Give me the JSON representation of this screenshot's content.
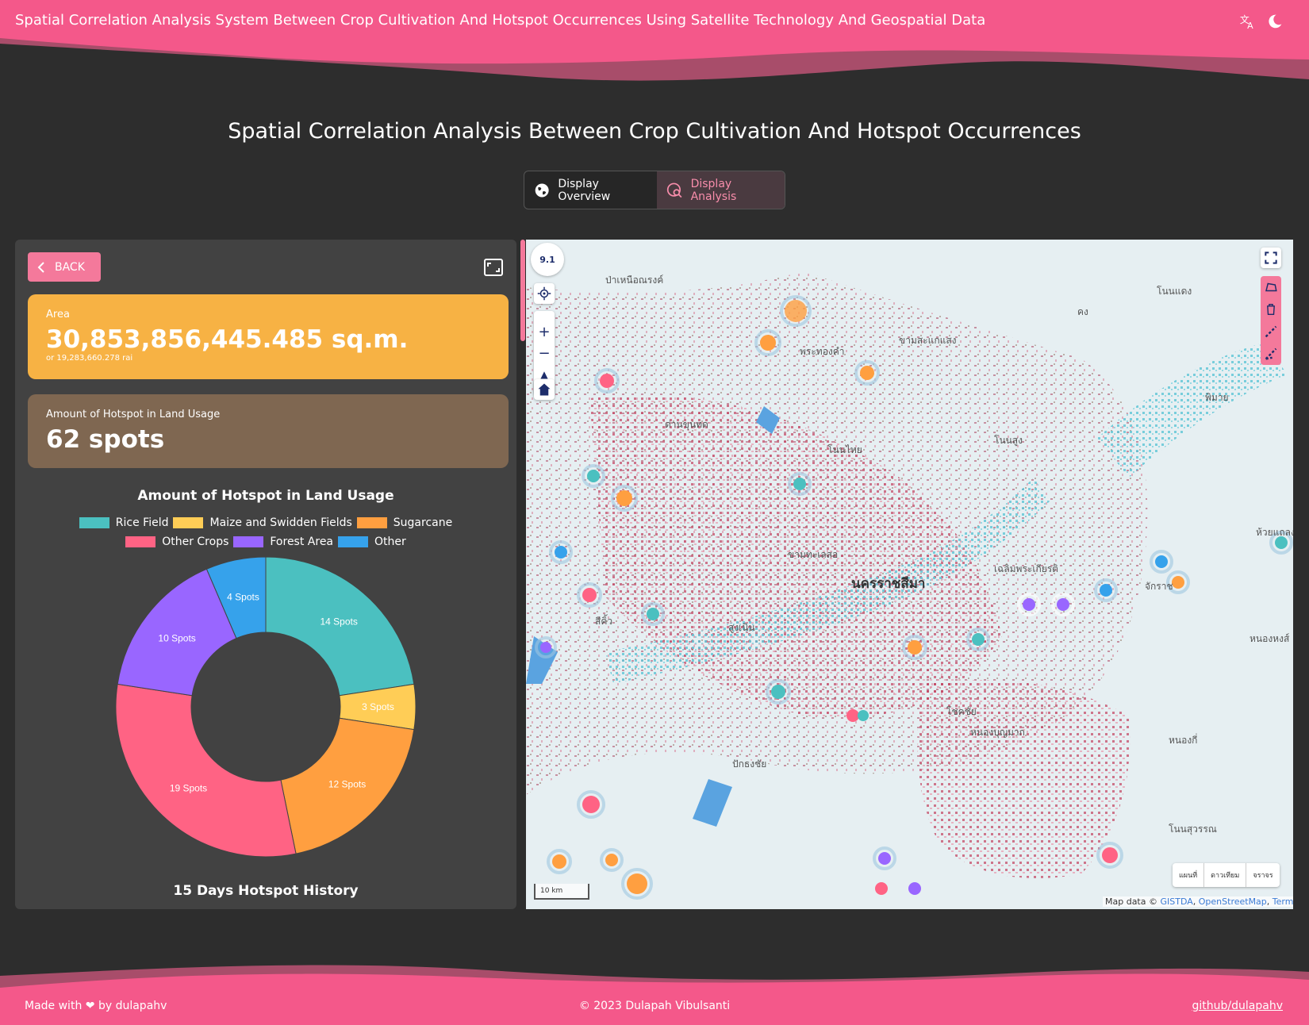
{
  "header": {
    "title": "Spatial Correlation Analysis System Between Crop Cultivation And Hotspot Occurrences Using Satellite Technology And Geospatial Data",
    "translate_icon": "translate-icon",
    "theme_icon": "moon-icon"
  },
  "page_title": "Spatial Correlation Analysis Between Crop Cultivation And Hotspot Occurrences",
  "view_toggle": {
    "overview_label": "Display Overview",
    "analysis_label": "Display Analysis",
    "active": "analysis"
  },
  "panel": {
    "back_label": "BACK",
    "area": {
      "label": "Area",
      "value": "30,853,856,445.485 sq.m.",
      "sub": "or 19,283,660.278 rai"
    },
    "hotspots": {
      "label": "Amount of Hotspot in Land Usage",
      "value": "62 spots"
    },
    "chart_title": "Amount of Hotspot in Land Usage",
    "history_title": "15 Days Hotspot History"
  },
  "chart_data": {
    "type": "pie",
    "title": "Amount of Hotspot in Land Usage",
    "legend_position": "top",
    "categories": [
      "Rice Field",
      "Maize and Swidden Fields",
      "Sugarcane",
      "Other Crops",
      "Forest Area",
      "Other"
    ],
    "values": [
      14,
      3,
      12,
      19,
      10,
      4
    ],
    "labels": [
      "14 Spots",
      "3 Spots",
      "12 Spots",
      "19 Spots",
      "10 Spots",
      "4 Spots"
    ],
    "colors": [
      "#4bc0c0",
      "#ffcd56",
      "#ff9f40",
      "#ff6384",
      "#9966ff",
      "#36a2eb"
    ]
  },
  "map": {
    "zoom_level": "9.1",
    "labels": [
      "ป่าเหนือณรงค์",
      "พระทองคำ",
      "ขามสะแกแสง",
      "ด่านขุนทด",
      "โนนไทย",
      "โนนสูง",
      "พิมาย",
      "โนนแดง",
      "คง",
      "ขามทะเลสอ",
      "นครราชสีมา",
      "เฉลิมพระเกียรติ",
      "จักราช",
      "ห้วยแถลง",
      "สีคิ้ว",
      "สูงเนิน",
      "หนองหงส์",
      "โชคชัย",
      "หนองบุญมาก",
      "หนองกี่",
      "ปักธงชัย",
      "โนนสุวรรณ"
    ],
    "base_layers": [
      "แผนที่",
      "ดาวเทียม",
      "จราจร"
    ],
    "scale": "10 km",
    "attribution_prefix": "Map data ©",
    "attribution_links": [
      "GISTDA",
      "OpenStreetMap",
      "Terms"
    ]
  },
  "footer": {
    "made_with": "Made with",
    "by": "by dulapahv",
    "copyright": "© 2023 Dulapah Vibulsanti",
    "github": "github/dulapahv"
  },
  "colors": {
    "accent": "#f4799b",
    "area_card": "#f7b244",
    "spots_card": "#7f6751"
  }
}
